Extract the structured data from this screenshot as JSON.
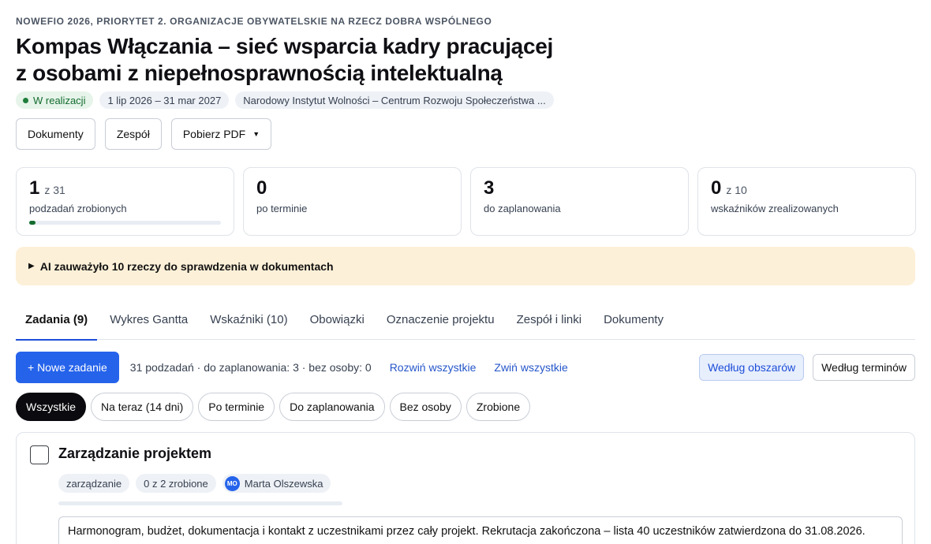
{
  "header": {
    "eyebrow": "NOWEFIO 2026, PRIORYTET 2. ORGANIZACJE OBYWATELSKIE NA RZECZ DOBRA WSPÓLNEGO",
    "title_line1": "Kompas Włączania – sieć wsparcia kadry pracującej",
    "title_line2": "z osobami z niepełnosprawnością intelektualną",
    "status": "W realizacji",
    "dates": "1 lip 2026 – 31 mar 2027",
    "organization": "Narodowy Instytut Wolności – Centrum Rozwoju Społeczeństwa ..."
  },
  "actions": {
    "documents": "Dokumenty",
    "team": "Zespół",
    "pdf": "Pobierz PDF"
  },
  "stats": [
    {
      "value": "1",
      "of": "z 31",
      "label": "podzadań zrobionych",
      "progress": 0.032
    },
    {
      "value": "0",
      "of": "",
      "label": "po terminie"
    },
    {
      "value": "3",
      "of": "",
      "label": "do zaplanowania"
    },
    {
      "value": "0",
      "of": "z 10",
      "label": "wskaźników zrealizowanych"
    }
  ],
  "ai_notice": "AI zauważyło 10 rzeczy do sprawdzenia w dokumentach",
  "tabs": [
    "Zadania (9)",
    "Wykres Gantta",
    "Wskaźniki (10)",
    "Obowiązki",
    "Oznaczenie projektu",
    "Zespół i linki",
    "Dokumenty"
  ],
  "toolbar": {
    "new_task": "+ Nowe zadanie",
    "summary": "31 podzadań · do zaplanowania: 3 · bez osoby: 0",
    "expand_all": "Rozwiń wszystkie",
    "collapse_all": "Zwiń wszystkie",
    "by_area": "Według obszarów",
    "by_deadline": "Według terminów"
  },
  "filters": [
    "Wszystkie",
    "Na teraz (14 dni)",
    "Po terminie",
    "Do zaplanowania",
    "Bez osoby",
    "Zrobione"
  ],
  "task": {
    "title": "Zarządzanie projektem",
    "tag_area": "zarządzanie",
    "tag_progress": "0 z 2 zrobione",
    "assignee_initials": "MO",
    "assignee": "Marta Olszewska",
    "progress": 0,
    "description": "Harmonogram, budżet, dokumentacja i kontakt z uczestnikami przez cały projekt. Rekrutacja zakończona – lista 40 uczestników zatwierdzona do 31.08.2026."
  },
  "colors": {
    "accent": "#2563eb",
    "status_green": "#146c2e",
    "notice_bg": "#fdf0d8"
  }
}
